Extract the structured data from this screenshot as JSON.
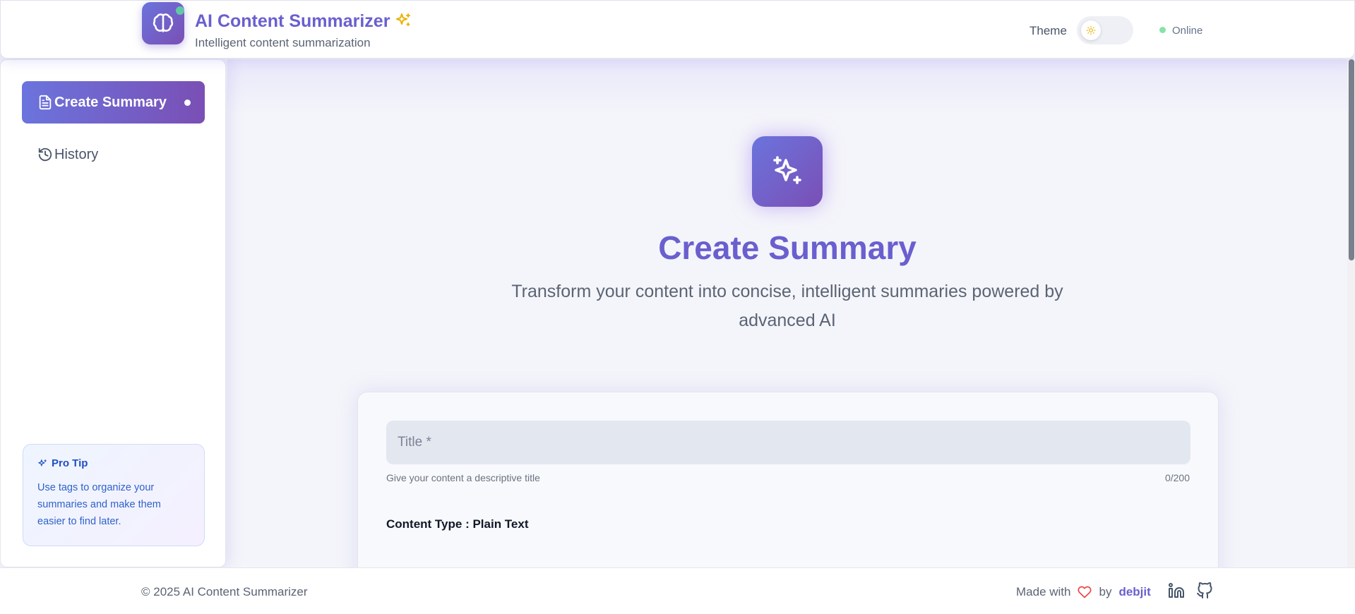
{
  "header": {
    "app_title": "AI Content Summarizer",
    "app_subtitle": "Intelligent content summarization",
    "theme_label": "Theme",
    "status_text": "Online"
  },
  "sidebar": {
    "items": [
      {
        "label": "Create Summary",
        "icon": "document-icon",
        "active": true
      },
      {
        "label": "History",
        "icon": "history-icon",
        "active": false
      }
    ],
    "pro_tip": {
      "title": "Pro Tip",
      "text": "Use tags to organize your summaries and make them easier to find later."
    }
  },
  "main": {
    "title": "Create Summary",
    "subtitle": "Transform your content into concise, intelligent summaries powered by advanced AI",
    "form": {
      "title_placeholder": "Title *",
      "title_value": "",
      "title_helper": "Give your content a descriptive title",
      "char_count": "0/200",
      "content_type": "Content Type : Plain Text"
    }
  },
  "footer": {
    "copyright": "© 2025 AI Content Summarizer",
    "made_with": "Made with",
    "by": "by",
    "author": "debjit"
  },
  "colors": {
    "accent": "#6a5fcf",
    "gradient_start": "#6b74dd",
    "gradient_end": "#7a4fb5",
    "online": "#86e3a8",
    "heart": "#ef4444",
    "sparkle": "#eab308"
  }
}
